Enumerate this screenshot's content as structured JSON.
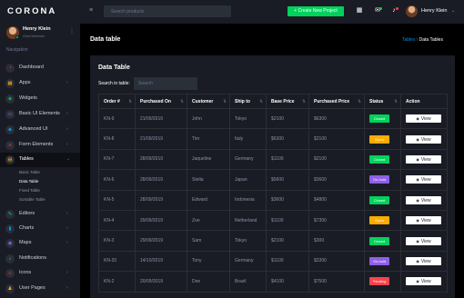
{
  "brand": "CORONA",
  "profile": {
    "name": "Henry Klein",
    "role": "Gold Member"
  },
  "nav_heading": "Navigation",
  "nav": [
    {
      "label": "Dashboard",
      "icon": "speedometer-icon",
      "glyph": "◔",
      "color": "#fc424a",
      "arrow": false
    },
    {
      "label": "Apps",
      "icon": "apps-icon",
      "glyph": "▦",
      "color": "#ffab00",
      "arrow": true
    },
    {
      "label": "Widgets",
      "icon": "widgets-icon",
      "glyph": "◈",
      "color": "#00d25b",
      "arrow": false
    },
    {
      "label": "Basic UI Elements",
      "icon": "laptop-icon",
      "glyph": "▭",
      "color": "#8f5fe8",
      "arrow": true
    },
    {
      "label": "Advanced UI",
      "icon": "security-icon",
      "glyph": "◆",
      "color": "#0090e7",
      "arrow": true
    },
    {
      "label": "Form Elements",
      "icon": "form-icon",
      "glyph": "≡",
      "color": "#fc424a",
      "arrow": true
    },
    {
      "label": "Tables",
      "icon": "table-icon",
      "glyph": "▤",
      "color": "#ffab00",
      "arrow": true
    },
    {
      "label": "Editors",
      "icon": "editor-icon",
      "glyph": "✎",
      "color": "#00d25b",
      "arrow": true
    },
    {
      "label": "Charts",
      "icon": "chart-icon",
      "glyph": "▮",
      "color": "#0090e7",
      "arrow": true
    },
    {
      "label": "Maps",
      "icon": "map-icon",
      "glyph": "◉",
      "color": "#8f5fe8",
      "arrow": true
    },
    {
      "label": "Notifications",
      "icon": "bell-icon",
      "glyph": "♪",
      "color": "#00d25b",
      "arrow": false
    },
    {
      "label": "Icons",
      "icon": "face-icon",
      "glyph": "☺",
      "color": "#fc424a",
      "arrow": true
    },
    {
      "label": "User Pages",
      "icon": "user-icon",
      "glyph": "♟",
      "color": "#ffab00",
      "arrow": true
    }
  ],
  "tables_sub": [
    "Basic Table",
    "Data Table",
    "Fixed Table",
    "Sortable Table"
  ],
  "topbar": {
    "search_placeholder": "Search products",
    "create_label": "+ Create New Project",
    "user_name": "Henry Klein"
  },
  "page": {
    "title": "Data table"
  },
  "breadcrumb": {
    "link": "Tables",
    "separator": " / ",
    "current": "Data Tables"
  },
  "card": {
    "title": "Data Table",
    "search_label": "Search in table:",
    "search_placeholder": "Search"
  },
  "table": {
    "headers": [
      "Order #",
      "Purchased On",
      "Customer",
      "Ship to",
      "Base Price",
      "Purchased Price",
      "Status",
      "Action"
    ],
    "action_label": "View",
    "rows": [
      {
        "order": "KN-9",
        "date": "21/09/2019",
        "customer": "John",
        "ship": "Tokyo",
        "base": "$2100",
        "purchased": "$6300",
        "status": "Closed",
        "status_color": "#00d25b"
      },
      {
        "order": "KN-8",
        "date": "21/09/2019",
        "customer": "Tim",
        "ship": "Italy",
        "base": "$6300",
        "purchased": "$2100",
        "status": "Open",
        "status_color": "#ffab00"
      },
      {
        "order": "KN-7",
        "date": "28/09/2019",
        "customer": "Jaqueline",
        "ship": "Germany",
        "base": "$1100",
        "purchased": "$2100",
        "status": "Closed",
        "status_color": "#00d25b"
      },
      {
        "order": "KN-6",
        "date": "28/09/2019",
        "customer": "Stella",
        "ship": "Japan",
        "base": "$5600",
        "purchased": "$3600",
        "status": "On-hold",
        "status_color": "#8f5fe8"
      },
      {
        "order": "KN-5",
        "date": "28/09/2019",
        "customer": "Edward",
        "ship": "Indonesia",
        "base": "$3600",
        "purchased": "$4800",
        "status": "Closed",
        "status_color": "#00d25b"
      },
      {
        "order": "KN-4",
        "date": "29/09/2019",
        "customer": "Zoe",
        "ship": "Netherland",
        "base": "$1100",
        "purchased": "$7300",
        "status": "Open",
        "status_color": "#ffab00"
      },
      {
        "order": "KN-3",
        "date": "29/09/2019",
        "customer": "Sam",
        "ship": "Tokyo",
        "base": "$2100",
        "purchased": "$300",
        "status": "Closed",
        "status_color": "#00d25b"
      },
      {
        "order": "KN-20",
        "date": "14/10/2019",
        "customer": "Tony",
        "ship": "Germany",
        "base": "$1100",
        "purchased": "$3300",
        "status": "On-hold",
        "status_color": "#8f5fe8"
      },
      {
        "order": "KN-2",
        "date": "20/09/2019",
        "customer": "Doe",
        "ship": "Brazil",
        "base": "$4100",
        "purchased": "$7500",
        "status": "Pending",
        "status_color": "#fc424a"
      }
    ]
  }
}
